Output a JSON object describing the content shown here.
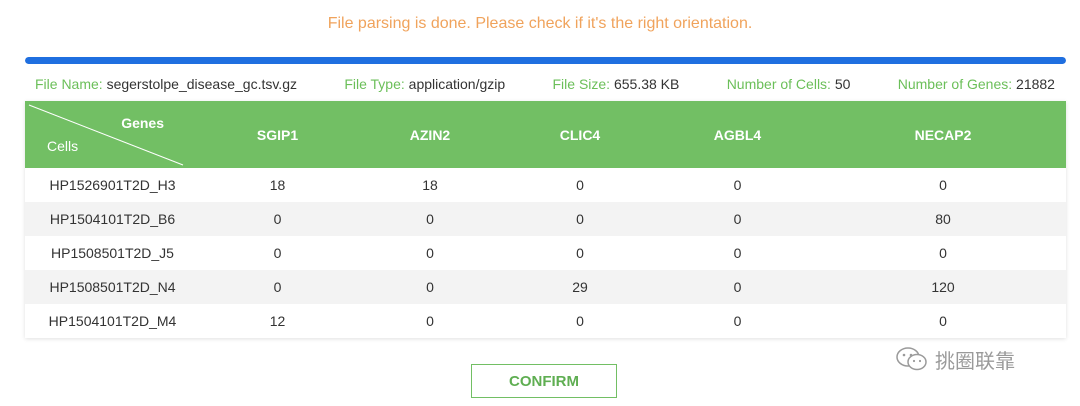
{
  "status_message": "File parsing is done. Please check if it's the right orientation.",
  "progress": 1.0,
  "colors": {
    "accent_green": "#72bf64",
    "status_orange": "#f0a35c",
    "progress_blue": "#1f6fe0"
  },
  "file_info": {
    "name_label": "File Name:",
    "name_value": "segerstolpe_disease_gc.tsv.gz",
    "type_label": "File Type:",
    "type_value": "application/gzip",
    "size_label": "File Size:",
    "size_value": "655.38 KB",
    "cells_label": "Number of Cells:",
    "cells_value": "50",
    "genes_label": "Number of Genes:",
    "genes_value": "21882"
  },
  "table": {
    "corner_top": "Genes",
    "corner_bottom": "Cells",
    "columns": [
      "SGIP1",
      "AZIN2",
      "CLIC4",
      "AGBL4",
      "NECAP2"
    ],
    "rows": [
      {
        "cell": "HP1526901T2D_H3",
        "values": [
          "18",
          "18",
          "0",
          "0",
          "0"
        ]
      },
      {
        "cell": "HP1504101T2D_B6",
        "values": [
          "0",
          "0",
          "0",
          "0",
          "80"
        ]
      },
      {
        "cell": "HP1508501T2D_J5",
        "values": [
          "0",
          "0",
          "0",
          "0",
          "0"
        ]
      },
      {
        "cell": "HP1508501T2D_N4",
        "values": [
          "0",
          "0",
          "29",
          "0",
          "120"
        ]
      },
      {
        "cell": "HP1504101T2D_M4",
        "values": [
          "12",
          "0",
          "0",
          "0",
          "0"
        ]
      }
    ]
  },
  "confirm_label": "CONFIRM",
  "watermark": {
    "icon": "wechat-icon",
    "text": "挑圈联靠"
  }
}
